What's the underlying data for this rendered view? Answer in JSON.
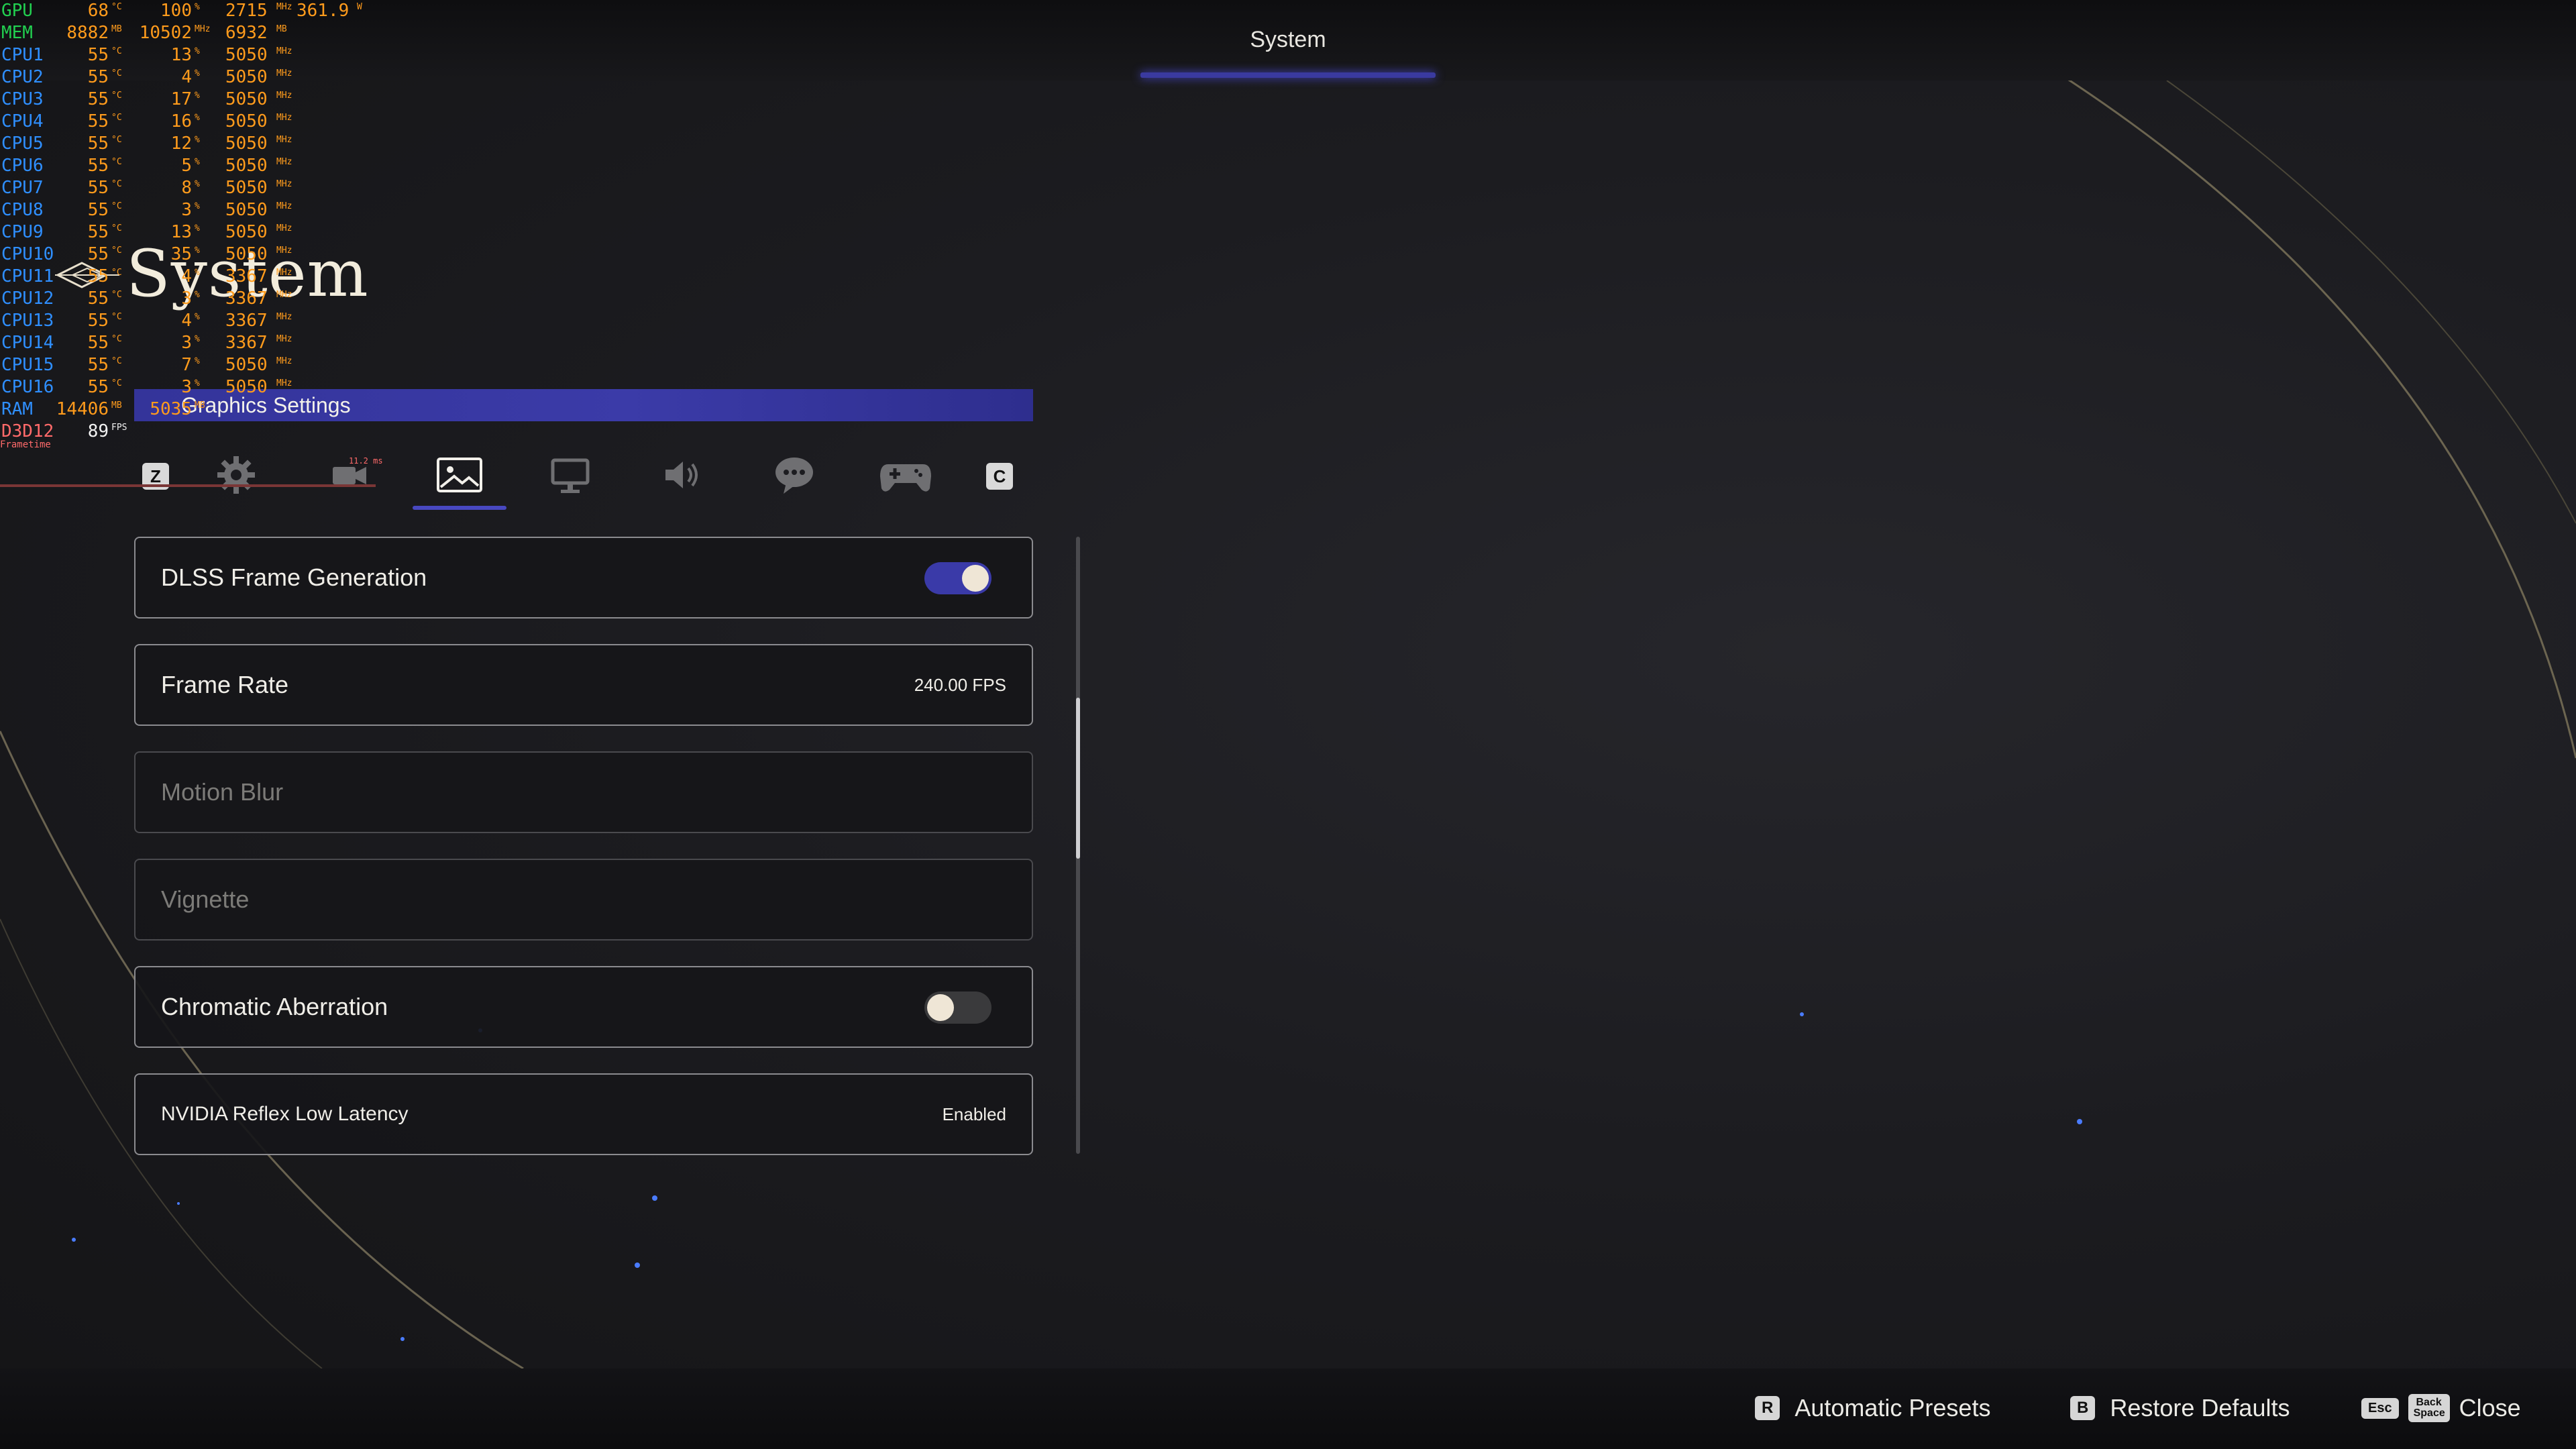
{
  "header": {
    "title": "System"
  },
  "page": {
    "title": "System"
  },
  "section": {
    "label": "Graphics Settings"
  },
  "tabs": {
    "left_key": "Z",
    "right_key": "C",
    "items": [
      {
        "icon": "gear-icon",
        "label": "General"
      },
      {
        "icon": "camera-icon",
        "label": "Camera"
      },
      {
        "icon": "image-icon",
        "label": "Graphics",
        "active": true
      },
      {
        "icon": "monitor-icon",
        "label": "Display"
      },
      {
        "icon": "speaker-icon",
        "label": "Sound"
      },
      {
        "icon": "chat-bubble-icon",
        "label": "Text"
      },
      {
        "icon": "gamepad-icon",
        "label": "Controls"
      }
    ]
  },
  "settings": [
    {
      "label": "DLSS Frame Generation",
      "type": "toggle",
      "on": true
    },
    {
      "label": "Frame Rate",
      "type": "value",
      "value": "240.00 FPS"
    },
    {
      "label": "Motion Blur",
      "type": "disabled"
    },
    {
      "label": "Vignette",
      "type": "disabled"
    },
    {
      "label": "Chromatic Aberration",
      "type": "toggle",
      "on": false
    },
    {
      "label": "NVIDIA Reflex Low Latency",
      "type": "value",
      "value": "Enabled"
    }
  ],
  "footer": {
    "automatic_presets": {
      "key": "R",
      "label": "Automatic Presets"
    },
    "restore_defaults": {
      "key": "B",
      "label": "Restore Defaults"
    },
    "close": {
      "key1": "Esc",
      "key2": "Back Space",
      "label": "Close"
    }
  },
  "osd": {
    "gpu": {
      "label": "GPU",
      "temp": "68",
      "load": "100",
      "clock": "2715",
      "power": "361.9"
    },
    "mem": {
      "label": "MEM",
      "used": "8882",
      "clock": "10502",
      "extra": "6932"
    },
    "cpus": [
      {
        "label": "CPU1",
        "temp": "55",
        "load": "13",
        "clock": "5050"
      },
      {
        "label": "CPU2",
        "temp": "55",
        "load": "4",
        "clock": "5050"
      },
      {
        "label": "CPU3",
        "temp": "55",
        "load": "17",
        "clock": "5050"
      },
      {
        "label": "CPU4",
        "temp": "55",
        "load": "16",
        "clock": "5050"
      },
      {
        "label": "CPU5",
        "temp": "55",
        "load": "12",
        "clock": "5050"
      },
      {
        "label": "CPU6",
        "temp": "55",
        "load": "5",
        "clock": "5050"
      },
      {
        "label": "CPU7",
        "temp": "55",
        "load": "8",
        "clock": "5050"
      },
      {
        "label": "CPU8",
        "temp": "55",
        "load": "3",
        "clock": "5050"
      },
      {
        "label": "CPU9",
        "temp": "55",
        "load": "13",
        "clock": "5050"
      },
      {
        "label": "CPU10",
        "temp": "55",
        "load": "35",
        "clock": "5050"
      },
      {
        "label": "CPU11",
        "temp": "55",
        "load": "4",
        "clock": "3367"
      },
      {
        "label": "CPU12",
        "temp": "55",
        "load": "3",
        "clock": "3367"
      },
      {
        "label": "CPU13",
        "temp": "55",
        "load": "4",
        "clock": "3367"
      },
      {
        "label": "CPU14",
        "temp": "55",
        "load": "3",
        "clock": "3367"
      },
      {
        "label": "CPU15",
        "temp": "55",
        "load": "7",
        "clock": "5050"
      },
      {
        "label": "CPU16",
        "temp": "55",
        "load": "3",
        "clock": "5050"
      }
    ],
    "ram": {
      "label": "RAM",
      "used": "14406",
      "extra": "5035"
    },
    "d3d": {
      "label": "D3D12",
      "fps": "89"
    },
    "frametime_label": "Frametime",
    "frametime_value": "11.2 ms"
  },
  "colors": {
    "accent": "#3a3aa8",
    "osd_orange": "#ff9b1c",
    "osd_green": "#22d050",
    "osd_blue": "#2f8fff"
  }
}
